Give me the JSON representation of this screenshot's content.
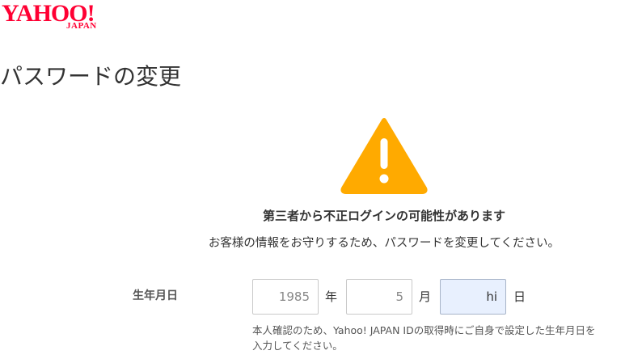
{
  "brand": {
    "logo_main": "YAHOO!",
    "logo_sub": "JAPAN",
    "color": "#ff0033"
  },
  "page": {
    "title": "パスワードの変更"
  },
  "warning": {
    "icon": "warning-icon",
    "icon_color": "#ffaa00",
    "heading": "第三者から不正ログインの可能性があります",
    "description": "お客様の情報をお守りするため、パスワードを変更してください。"
  },
  "birthday": {
    "label": "生年月日",
    "year_value": "1985",
    "year_unit": "年",
    "month_value": "5",
    "month_unit": "月",
    "day_value": "hi",
    "day_unit": "日",
    "help_line1": "本人確認のため、Yahoo! JAPAN IDの取得時にご自身で設定した生年月日を",
    "help_line2": "入力してください。"
  }
}
